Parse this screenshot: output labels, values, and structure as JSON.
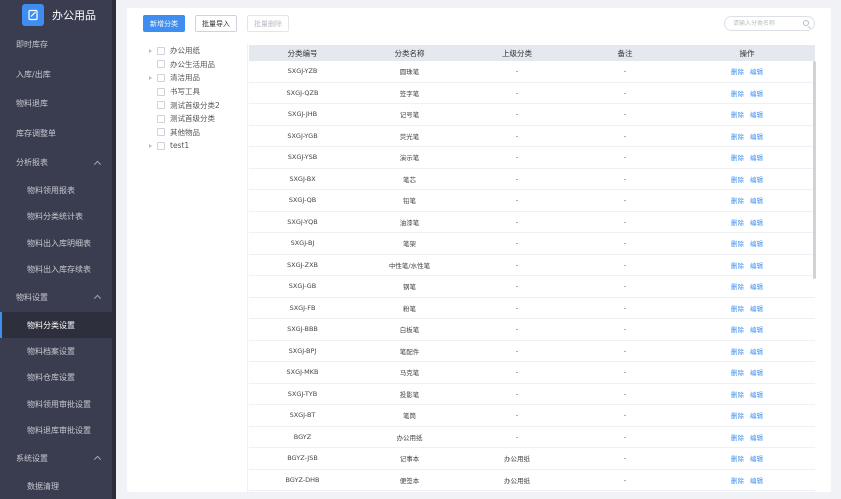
{
  "app": {
    "title": "办公用品"
  },
  "sidebar": {
    "items": [
      {
        "label": "即时库存",
        "type": "top"
      },
      {
        "label": "入库/出库",
        "type": "top"
      },
      {
        "label": "物料退库",
        "type": "top"
      },
      {
        "label": "库存调整单",
        "type": "top"
      },
      {
        "label": "分析报表",
        "type": "group"
      },
      {
        "label": "物料领用报表",
        "type": "sub"
      },
      {
        "label": "物料分类统计表",
        "type": "sub"
      },
      {
        "label": "物料出入库明细表",
        "type": "sub"
      },
      {
        "label": "物料出入库存续表",
        "type": "sub"
      },
      {
        "label": "物料设置",
        "type": "group"
      },
      {
        "label": "物料分类设置",
        "type": "sub",
        "active": true
      },
      {
        "label": "物料档案设置",
        "type": "sub"
      },
      {
        "label": "物料仓库设置",
        "type": "sub"
      },
      {
        "label": "物料领用审批设置",
        "type": "sub"
      },
      {
        "label": "物料退库审批设置",
        "type": "sub"
      },
      {
        "label": "系统设置",
        "type": "group"
      },
      {
        "label": "数据清理",
        "type": "sub"
      }
    ]
  },
  "toolbar": {
    "add_label": "新增分类",
    "import_label": "批量导入",
    "delete_label": "批量删除",
    "search_placeholder": "请输入分类名称"
  },
  "tree": [
    {
      "label": "办公用纸",
      "level": 0,
      "expandable": true
    },
    {
      "label": "办公生活用品",
      "level": 0,
      "expandable": false
    },
    {
      "label": "清洁用品",
      "level": 0,
      "expandable": true
    },
    {
      "label": "书写工具",
      "level": 0,
      "expandable": false
    },
    {
      "label": "测试首级分类2",
      "level": 0,
      "expandable": false
    },
    {
      "label": "测试首级分类",
      "level": 0,
      "expandable": false
    },
    {
      "label": "其他物品",
      "level": 0,
      "expandable": false
    },
    {
      "label": "test1",
      "level": 0,
      "expandable": true
    }
  ],
  "table": {
    "columns": [
      "分类编号",
      "分类名称",
      "上级分类",
      "备注",
      "操作"
    ],
    "action_delete": "删除",
    "action_edit": "编辑",
    "rows": [
      [
        "SXGJ-YZB",
        "圆珠笔",
        "-",
        "-"
      ],
      [
        "SXGJ-QZB",
        "签字笔",
        "-",
        "-"
      ],
      [
        "SXGJ-JHB",
        "记号笔",
        "-",
        "-"
      ],
      [
        "SXGJ-YGB",
        "荧光笔",
        "-",
        "-"
      ],
      [
        "SXGJ-YSB",
        "演示笔",
        "-",
        "-"
      ],
      [
        "SXGJ-BX",
        "笔芯",
        "-",
        "-"
      ],
      [
        "SXGJ-QB",
        "铅笔",
        "-",
        "-"
      ],
      [
        "SXGJ-YQB",
        "油漆笔",
        "-",
        "-"
      ],
      [
        "SXGJ-BJ",
        "笔架",
        "-",
        "-"
      ],
      [
        "SXGJ-ZXB",
        "中性笔/水性笔",
        "-",
        "-"
      ],
      [
        "SXGJ-GB",
        "钢笔",
        "-",
        "-"
      ],
      [
        "SXGJ-FB",
        "粉笔",
        "-",
        "-"
      ],
      [
        "SXGJ-BBB",
        "白板笔",
        "-",
        "-"
      ],
      [
        "SXGJ-BPJ",
        "笔配件",
        "-",
        "-"
      ],
      [
        "SXGJ-MKB",
        "马克笔",
        "-",
        "-"
      ],
      [
        "SXGJ-TYB",
        "投影笔",
        "-",
        "-"
      ],
      [
        "SXGJ-BT",
        "笔筒",
        "-",
        "-"
      ],
      [
        "BGYZ",
        "办公用纸",
        "-",
        "-"
      ],
      [
        "BGYZ-JSB",
        "记事本",
        "办公用纸",
        "-"
      ],
      [
        "BGYZ-DHB",
        "便签本",
        "办公用纸",
        "-"
      ]
    ]
  }
}
